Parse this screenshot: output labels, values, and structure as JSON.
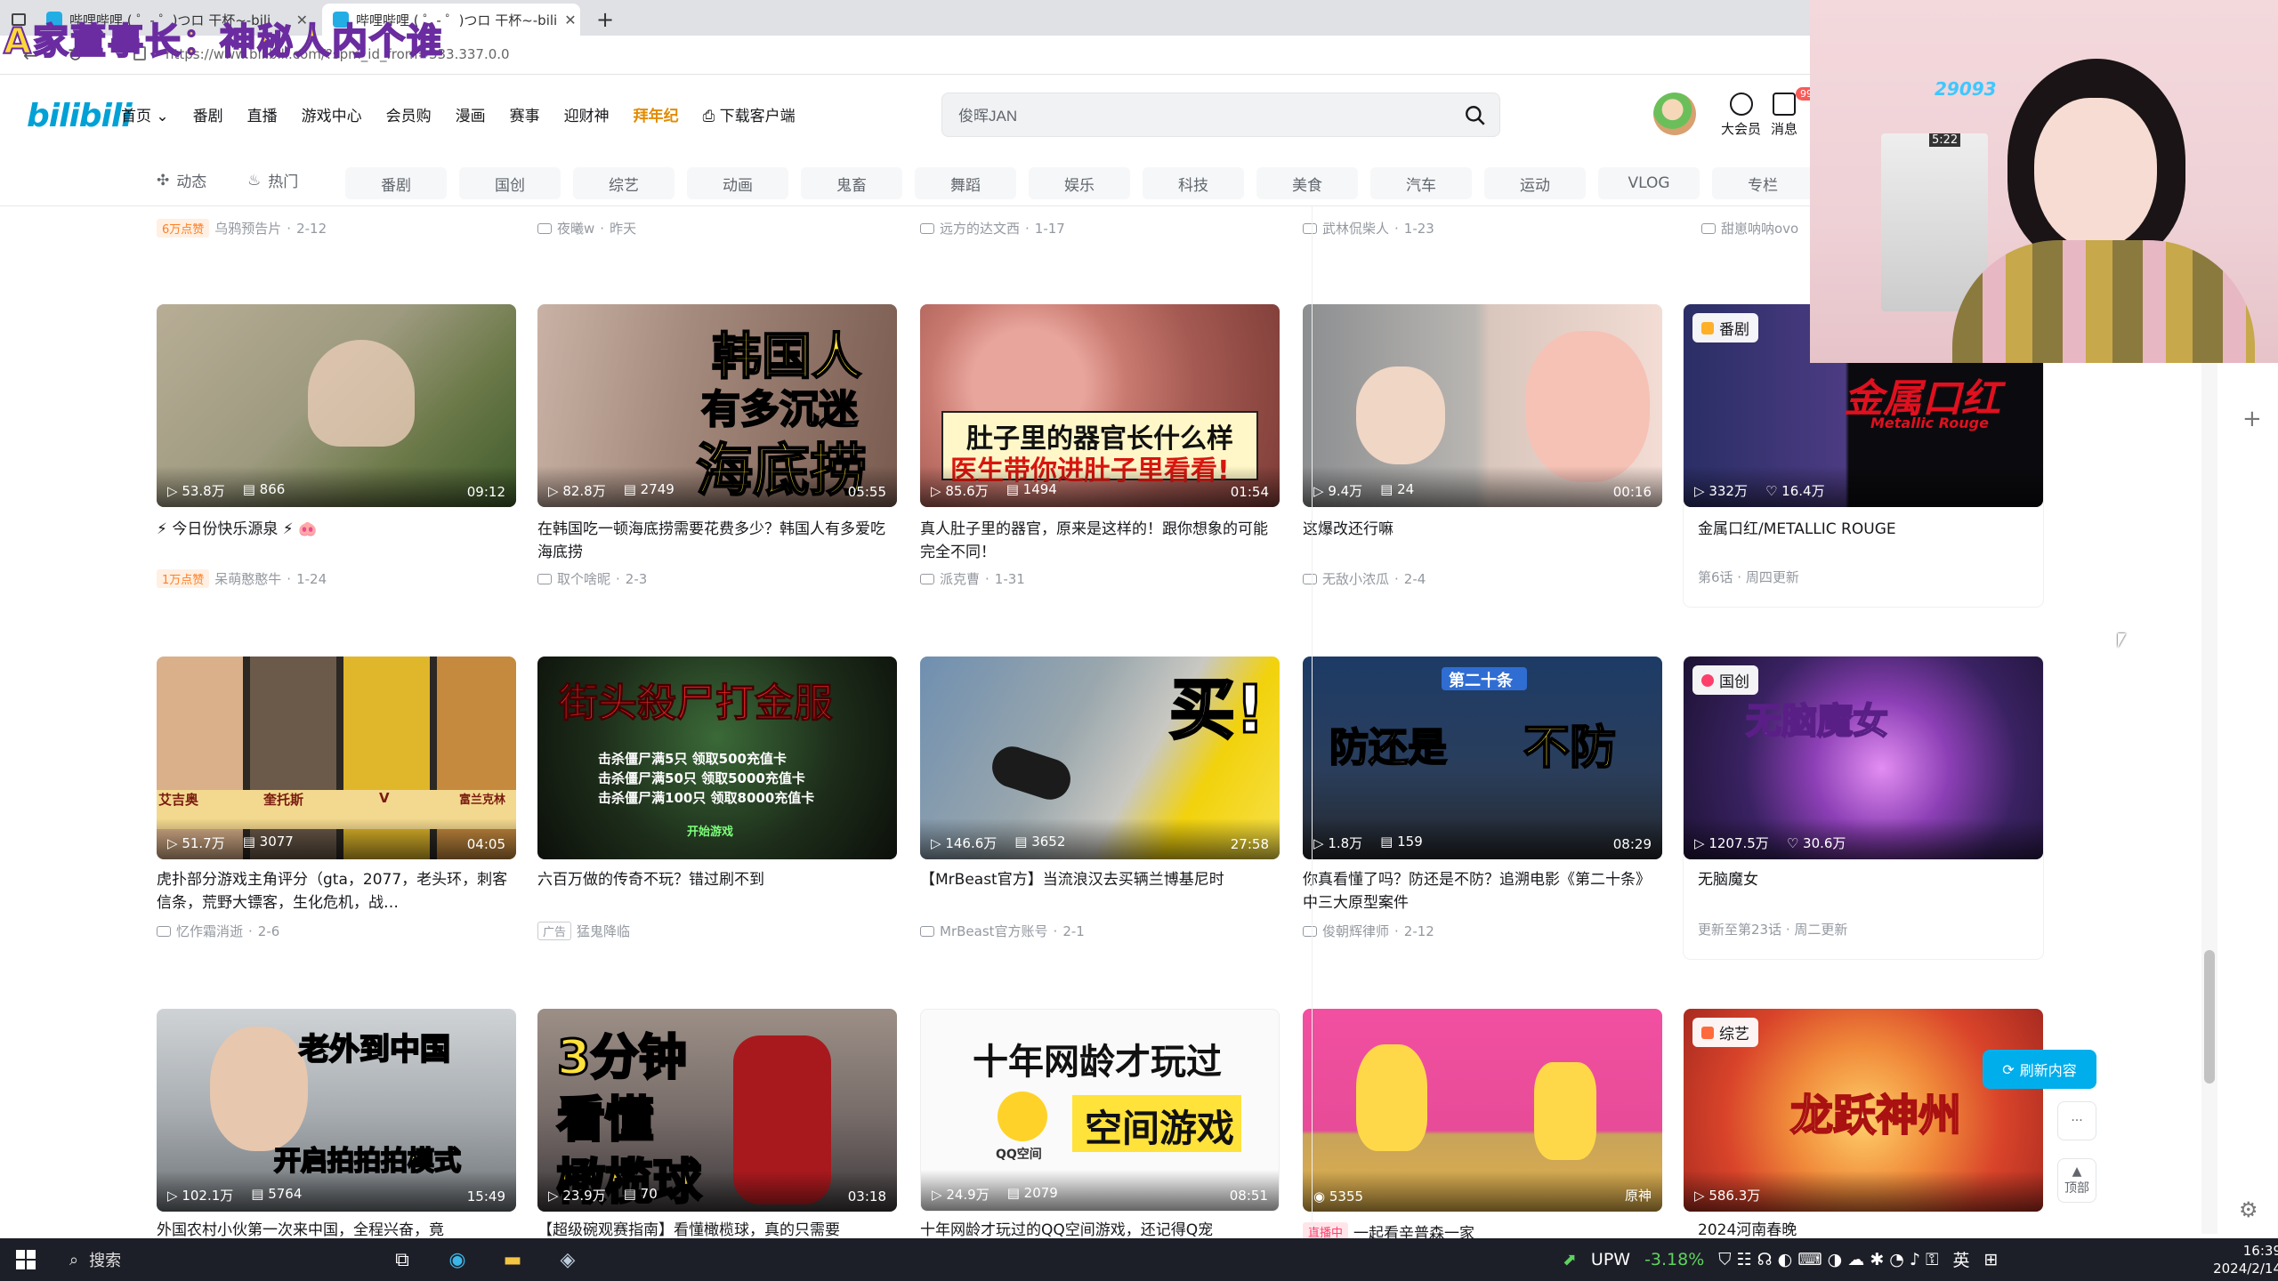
{
  "browser": {
    "tabs": [
      {
        "title": "哔哩哔哩 ( ゜- ゜)つロ 干杯~-bili"
      },
      {
        "title": "哔哩哔哩 ( ゜- ゜)つロ 干杯~-bili"
      }
    ],
    "new_tab": "+",
    "url": "https://www.bilibili.com/?spm_id_from=333.337.0.0",
    "overlay_text": "A家董事长：神秘人内个谁"
  },
  "header": {
    "logo": "bilibili",
    "nav": [
      "首页",
      "番剧",
      "直播",
      "游戏中心",
      "会员购",
      "漫画",
      "赛事",
      "迎财神",
      "拜年纪",
      "下载客户端"
    ],
    "search": {
      "placeholder": "",
      "value": "俊晖JAN"
    },
    "right_icons": [
      {
        "label": "大会员"
      },
      {
        "label": "消息"
      }
    ],
    "message_badge": "99+"
  },
  "channels": {
    "left": [
      {
        "label": "动态"
      },
      {
        "label": "热门"
      }
    ],
    "chips": [
      "番剧",
      "国创",
      "综艺",
      "动画",
      "鬼畜",
      "舞蹈",
      "娱乐",
      "科技",
      "美食",
      "汽车",
      "运动",
      "VLOG",
      "专栏"
    ]
  },
  "prev_row_meta": [
    {
      "tag": "6万点赞",
      "author": "乌鸦预告片",
      "date": "2-12"
    },
    {
      "author": "夜曦w",
      "date": "昨天"
    },
    {
      "author": "远方的达文西",
      "date": "1-17"
    },
    {
      "author": "武林侃柴人",
      "date": "1-23"
    },
    {
      "author": "甜崽呐呐ovo",
      "date": ""
    }
  ],
  "rows": [
    [
      {
        "views": "53.8万",
        "danmaku": "866",
        "duration": "09:12",
        "title": "⚡ 今日份快乐源泉 ⚡ 🐽",
        "tag": "1万点赞",
        "author": "呆萌憨憨牛",
        "date": "1-24"
      },
      {
        "views": "82.8万",
        "danmaku": "2749",
        "duration": "05:55",
        "overlay": [
          "韩国人",
          "有多沉迷",
          "海底捞"
        ],
        "title": "在韩国吃一顿海底捞需要花费多少？韩国人有多爱吃海底捞",
        "author": "取个啥昵",
        "date": "2-3"
      },
      {
        "views": "85.6万",
        "danmaku": "1494",
        "duration": "01:54",
        "overlay": [
          "肚子里的器官长什么样",
          "医生带你进肚子里看看!"
        ],
        "title": "真人肚子里的器官，原来是这样的！跟你想象的可能完全不同！",
        "author": "派克曹",
        "date": "1-31"
      },
      {
        "views": "9.4万",
        "danmaku": "24",
        "duration": "00:16",
        "title": "这爆改还行嘛",
        "author": "无敌小浓瓜",
        "date": "2-4"
      },
      {
        "badge": "番剧",
        "views": "332万",
        "likes": "16.4万",
        "overlay": [
          "金属口红",
          "Metallic Rouge"
        ],
        "title": "金属口红/METALLIC ROUGE",
        "sub": "第6话 · 周四更新"
      }
    ],
    [
      {
        "views": "51.7万",
        "danmaku": "3077",
        "duration": "04:05",
        "overlay": [
          "艾吉奥",
          "奎托斯",
          "V",
          "富兰克林"
        ],
        "title": "虎扑部分游戏主角评分（gta，2077，老头环，刺客信条，荒野大镖客，生化危机，战…",
        "author": "忆作霜消逝",
        "date": "2-6"
      },
      {
        "overlay": [
          "街头殺尸打金服",
          "击杀僵尸满5只 领取500充值卡",
          "击杀僵尸满50只 领取5000充值卡",
          "击杀僵尸满100只 领取8000充值卡",
          "开始游戏"
        ],
        "title": "六百万做的传奇不玩？错过刷不到",
        "ad": "广告",
        "author": "猛鬼降临"
      },
      {
        "views": "146.6万",
        "danmaku": "3652",
        "duration": "27:58",
        "overlay": [
          "买!"
        ],
        "title": "【MrBeast官方】当流浪汉去买辆兰博基尼时",
        "author": "MrBeast官方账号",
        "date": "2-1"
      },
      {
        "views": "1.8万",
        "danmaku": "159",
        "duration": "08:29",
        "overlay": [
          "第二十条",
          "防还是",
          "不防"
        ],
        "title": "你真看懂了吗？防还是不防？追溯电影《第二十条》中三大原型案件",
        "author": "俊朝辉律师",
        "date": "2-12"
      },
      {
        "badge": "国创",
        "views": "1207.5万",
        "likes": "30.6万",
        "overlay": [
          "无脑魔女"
        ],
        "title": "无脑魔女",
        "sub": "更新至第23话 · 周二更新"
      }
    ],
    [
      {
        "views": "102.1万",
        "danmaku": "5764",
        "duration": "15:49",
        "overlay": [
          "老外到中国",
          "开启拍拍拍模式"
        ],
        "title": "外国农村小伙第一次来中国，全程兴奋，竟"
      },
      {
        "views": "23.9万",
        "danmaku": "70",
        "duration": "03:18",
        "overlay": [
          "3分钟",
          "看懂",
          "橄榄球"
        ],
        "title": "【超级碗观赛指南】看懂橄榄球，真的只需要"
      },
      {
        "views": "24.9万",
        "danmaku": "2079",
        "duration": "08:51",
        "overlay": [
          "十年网龄才玩过",
          "空间游戏",
          "QQ空间"
        ],
        "title": "十年网龄才玩过的QQ空间游戏，还记得Q宠"
      },
      {
        "views": "5355",
        "duration": "原神",
        "tag_live": "直播中",
        "title": "一起看辛普森一家"
      },
      {
        "badge": "综艺",
        "views": "586.3万",
        "overlay": [
          "龙跃神州"
        ],
        "title": "2024河南春晚"
      }
    ]
  ],
  "side": {
    "refresh": "刷新内容",
    "more": "···",
    "top": "顶部"
  },
  "webcam": {
    "number": "29093",
    "time": "5:22"
  },
  "taskbar": {
    "search_placeholder": "搜索",
    "ticker": "UPW",
    "change": "-3.18%",
    "lang": "英",
    "time": "16:39",
    "date": "2024/2/14"
  },
  "colors": {
    "brand": "#00aeec",
    "overlay_yellow": "#ffd83a",
    "ticker_red": "#ff5b5b"
  }
}
